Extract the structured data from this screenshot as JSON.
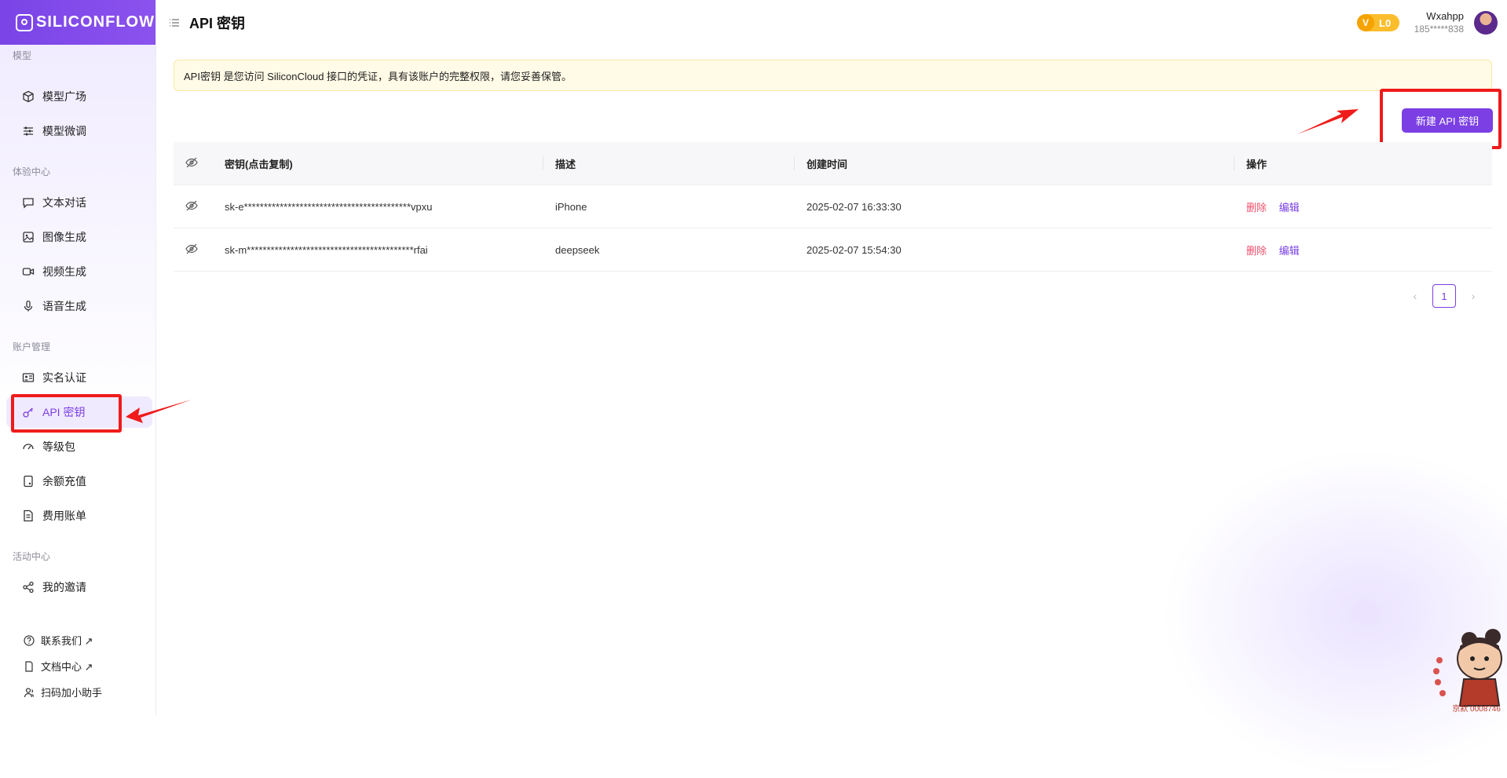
{
  "app": {
    "brand": "SILICONFLOW"
  },
  "header": {
    "title": "API 密钥",
    "level": {
      "icon": "V",
      "label": "L0"
    },
    "user": {
      "name": "Wxahpp",
      "phone": "185*****838"
    }
  },
  "sidebar": {
    "sections": [
      {
        "label": "模型",
        "items": [
          {
            "label": "模型广场",
            "icon": "cube-icon"
          },
          {
            "label": "模型微调",
            "icon": "sliders-icon"
          }
        ]
      },
      {
        "label": "体验中心",
        "items": [
          {
            "label": "文本对话",
            "icon": "chat-icon"
          },
          {
            "label": "图像生成",
            "icon": "image-icon"
          },
          {
            "label": "视频生成",
            "icon": "video-icon"
          },
          {
            "label": "语音生成",
            "icon": "mic-icon"
          }
        ]
      },
      {
        "label": "账户管理",
        "items": [
          {
            "label": "实名认证",
            "icon": "id-card-icon"
          },
          {
            "label": "API 密钥",
            "icon": "key-icon",
            "active": true
          },
          {
            "label": "等级包",
            "icon": "gauge-icon"
          },
          {
            "label": "余额充值",
            "icon": "wallet-icon"
          },
          {
            "label": "费用账单",
            "icon": "bill-icon"
          }
        ]
      },
      {
        "label": "活动中心",
        "items": [
          {
            "label": "我的邀请",
            "icon": "share-icon"
          }
        ]
      }
    ],
    "footer": [
      {
        "label": "联系我们 ↗",
        "icon": "help-icon"
      },
      {
        "label": "文档中心 ↗",
        "icon": "doc-icon"
      },
      {
        "label": "扫码加小助手",
        "icon": "user-icon"
      }
    ]
  },
  "notice": {
    "text": "API密钥 是您访问 SiliconCloud 接口的凭证，具有该账户的完整权限，请您妥善保管。"
  },
  "toolbar": {
    "new_key_label": "新建 API 密钥"
  },
  "table": {
    "headers": {
      "key": "密钥(点击复制)",
      "desc": "描述",
      "time": "创建时间",
      "ops": "操作"
    },
    "rows": [
      {
        "key": "sk-e******************************************vpxu",
        "desc": "iPhone",
        "time": "2025-02-07 16:33:30",
        "delete": "删除",
        "edit": "编辑"
      },
      {
        "key": "sk-m******************************************rfai",
        "desc": "deepseek",
        "time": "2025-02-07 15:54:30",
        "delete": "删除",
        "edit": "编辑"
      }
    ]
  },
  "pagination": {
    "current": "1",
    "prev": "‹",
    "next": "›"
  },
  "watermark": {
    "text": "京默 0008746"
  },
  "colors": {
    "accent": "#7b3fe4",
    "danger": "#f0506e",
    "highlight": "#ef1b1b"
  }
}
